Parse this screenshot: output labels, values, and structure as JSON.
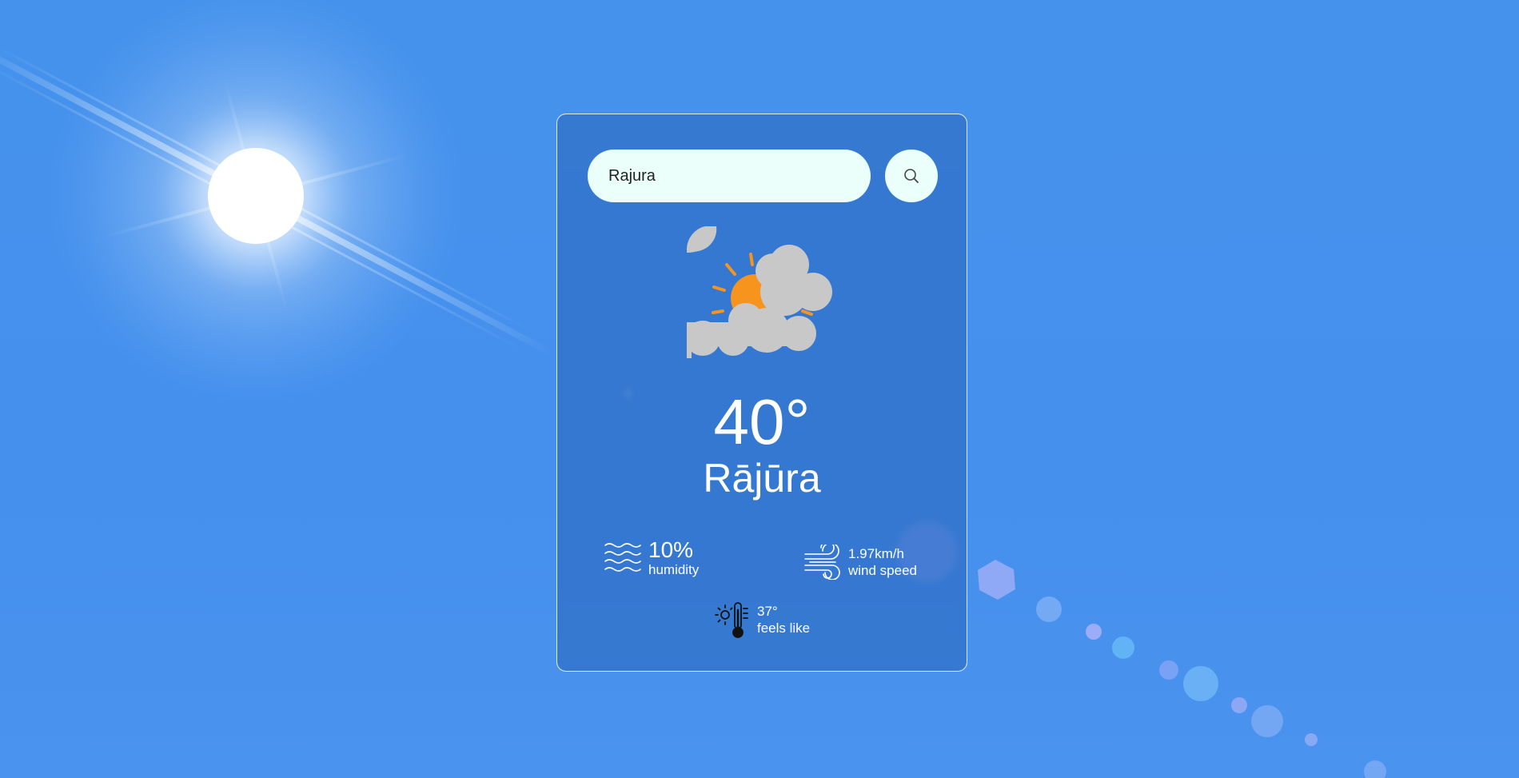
{
  "search": {
    "value": "Rajura",
    "placeholder": "",
    "button_icon": "search-icon"
  },
  "weather": {
    "icon": "partly-cloudy-icon",
    "temperature": "40°",
    "city": "Rājūra"
  },
  "details": {
    "humidity": {
      "value": "10%",
      "label": "humidity",
      "icon": "humidity-waves-icon"
    },
    "wind": {
      "value": "1.97km/h",
      "label": "wind speed",
      "icon": "wind-icon"
    },
    "feels_like": {
      "value": "37°",
      "label": "feels like",
      "icon": "thermometer-sun-icon"
    }
  },
  "colors": {
    "background": "#4592ec",
    "input_bg": "#ebfffb",
    "sun": "#f7941d",
    "cloud": "#c8c8c8"
  }
}
